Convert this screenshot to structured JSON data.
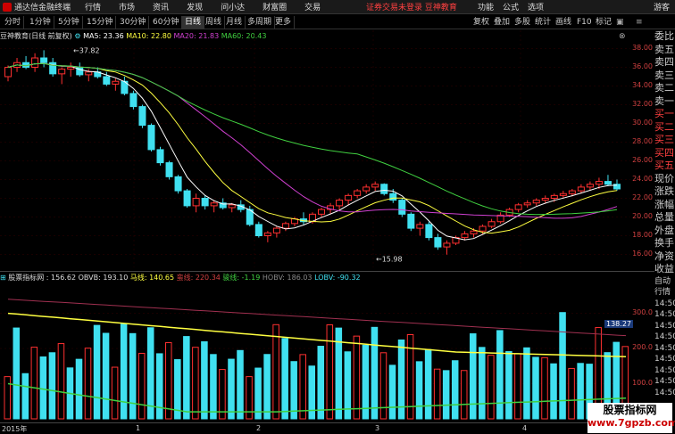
{
  "topbar": {
    "app_title": "通达信金融终端",
    "menu": [
      "行情",
      "市场",
      "资讯",
      "发现",
      "问小达",
      "财富圈",
      "交易"
    ],
    "broker_text": "证券交易未登录  豆神教育",
    "right_menu": [
      "功能",
      "公式",
      "选项"
    ],
    "guest": "游客"
  },
  "toolbar": {
    "periods": [
      "分时",
      "1分钟",
      "5分钟",
      "15分钟",
      "30分钟",
      "60分钟",
      "日线",
      "周线",
      "月线",
      "多周期",
      "更多"
    ],
    "active_period": "日线",
    "right_buttons": [
      "复权",
      "叠加",
      "多股",
      "统计",
      "画线",
      "F10",
      "标记"
    ]
  },
  "main_info": {
    "title": "豆神教育(日线 前复权)",
    "ma5": "MA5: 23.36",
    "ma10": "MA10: 22.80",
    "ma20": "MA20: 21.83",
    "ma60": "MA60: 20.43",
    "high_label": "37.82",
    "low_label": "15.98"
  },
  "main_axis": [
    "38.00",
    "36.00",
    "34.00",
    "32.00",
    "30.00",
    "28.00",
    "26.00",
    "24.00",
    "22.00",
    "20.00",
    "18.00",
    "16.00"
  ],
  "sub_info": {
    "title": "股票指标网",
    "v1": ": 156.62",
    "obvb": "OBVB: 193.10",
    "maxian": "马线: 140.65",
    "manxian": "蛮线: 220.34",
    "junxian": "骏线: -1.19",
    "hobv": "HOBV: 186.03",
    "lobv": "LOBV: -90.32",
    "current": "138.27"
  },
  "sub_axis": [
    "300.0",
    "200.0",
    "100.0"
  ],
  "xaxis": [
    "2015年",
    "1",
    "2",
    "3",
    "4"
  ],
  "sidepanel": [
    "委比",
    "卖五",
    "卖四",
    "卖三",
    "卖二",
    "卖一",
    "买一",
    "买二",
    "买三",
    "买四",
    "买五",
    "现价",
    "涨跌",
    "涨幅",
    "总量",
    "外盘",
    "换手",
    "净资",
    "收益",
    "自动",
    "行情",
    "14:50",
    "14:50",
    "14:50",
    "14:50",
    "14:50",
    "14:50",
    "14:50",
    "14:50",
    "14:50"
  ],
  "watermark": {
    "line1": "股票指标网",
    "line2": "www.7gpzb.com"
  },
  "colors": {
    "up": "#ff3030",
    "down": "#40e0f0",
    "ma5": "#ffffff",
    "ma10": "#ffff40",
    "ma20": "#d040d0",
    "ma60": "#40d040"
  },
  "chart_data": {
    "type": "candlestick",
    "candles": [
      [
        35,
        36.2,
        34.5,
        36
      ],
      [
        36,
        37,
        35.5,
        36.5
      ],
      [
        36.5,
        37.2,
        35.8,
        36
      ],
      [
        36,
        37.5,
        35.5,
        37
      ],
      [
        37,
        37.82,
        36,
        36.5
      ],
      [
        36.5,
        37,
        35,
        35.3
      ],
      [
        35.3,
        36,
        34.2,
        35.8
      ],
      [
        35.8,
        36.5,
        35,
        36
      ],
      [
        36,
        36.5,
        35,
        35.2
      ],
      [
        35.2,
        35.8,
        34.5,
        35.5
      ],
      [
        35.5,
        36,
        34.8,
        35
      ],
      [
        35,
        35.5,
        34,
        34.2
      ],
      [
        34.2,
        34.8,
        33.5,
        34.5
      ],
      [
        34.5,
        35,
        33,
        33.2
      ],
      [
        33.2,
        33.5,
        31.5,
        31.8
      ],
      [
        31.8,
        32,
        29.5,
        29.8
      ],
      [
        29.8,
        30,
        27,
        27.2
      ],
      [
        27.2,
        27.5,
        25.5,
        25.8
      ],
      [
        25.8,
        26,
        24,
        24.3
      ],
      [
        24.3,
        24.5,
        22.5,
        22.8
      ],
      [
        22.8,
        23,
        21,
        21.2
      ],
      [
        21.2,
        22.5,
        20.5,
        22
      ],
      [
        22,
        22.3,
        20.8,
        21.2
      ],
      [
        21.2,
        21.8,
        20.5,
        21.5
      ],
      [
        21.5,
        22,
        20.8,
        21
      ],
      [
        21,
        21.5,
        20.5,
        21.3
      ],
      [
        21.3,
        21.8,
        20.5,
        20.8
      ],
      [
        20.8,
        21.2,
        19,
        19.2
      ],
      [
        19.2,
        19.5,
        17.8,
        18
      ],
      [
        18,
        18.5,
        17.3,
        18.3
      ],
      [
        18.3,
        19,
        17.8,
        18.8
      ],
      [
        18.8,
        19.5,
        18.5,
        19.3
      ],
      [
        19.3,
        20,
        19,
        19.8
      ],
      [
        19.8,
        20.5,
        19.2,
        19.5
      ],
      [
        19.5,
        20.5,
        19.3,
        20.3
      ],
      [
        20.3,
        21,
        20,
        20.8
      ],
      [
        20.8,
        21.5,
        20.3,
        21.2
      ],
      [
        21.2,
        22,
        20.8,
        21.8
      ],
      [
        21.8,
        22.5,
        21.3,
        22.3
      ],
      [
        22.3,
        23,
        22,
        22.8
      ],
      [
        22.8,
        23.5,
        22.5,
        23.2
      ],
      [
        23.2,
        23.8,
        22.8,
        23.5
      ],
      [
        23.5,
        23.6,
        22.3,
        22.5
      ],
      [
        22.5,
        23,
        21.5,
        21.8
      ],
      [
        21.8,
        22,
        20,
        20.3
      ],
      [
        20.3,
        20.5,
        18.5,
        18.8
      ],
      [
        18.8,
        19.5,
        18,
        19.2
      ],
      [
        19.2,
        19.5,
        17.5,
        17.8
      ],
      [
        17.8,
        18.2,
        16.5,
        16.8
      ],
      [
        16.8,
        17.5,
        15.98,
        17.2
      ],
      [
        17.2,
        18,
        17,
        17.8
      ],
      [
        17.8,
        18.5,
        17.5,
        18.2
      ],
      [
        18.2,
        18.8,
        17.8,
        18.5
      ],
      [
        18.5,
        19.2,
        18.2,
        19
      ],
      [
        19,
        19.8,
        18.8,
        19.5
      ],
      [
        19.5,
        20.5,
        19.3,
        20.2
      ],
      [
        20.2,
        21,
        20,
        20.8
      ],
      [
        20.8,
        21.5,
        20.5,
        21.3
      ],
      [
        21.3,
        21.8,
        21,
        21.5
      ],
      [
        21.5,
        22,
        21.2,
        21.8
      ],
      [
        21.8,
        22.3,
        21.5,
        22
      ],
      [
        22,
        22.5,
        21.6,
        22.3
      ],
      [
        22.3,
        22.8,
        22,
        22.5
      ],
      [
        22.5,
        23,
        22.2,
        22.8
      ],
      [
        22.8,
        23.5,
        22.5,
        23.2
      ],
      [
        23.2,
        23.8,
        22.8,
        23.5
      ],
      [
        23.5,
        24.2,
        23,
        23.8
      ],
      [
        23.8,
        24.5,
        23.3,
        23.5
      ],
      [
        23.5,
        24,
        22.8,
        23
      ]
    ],
    "ylim": [
      15,
      39
    ]
  }
}
